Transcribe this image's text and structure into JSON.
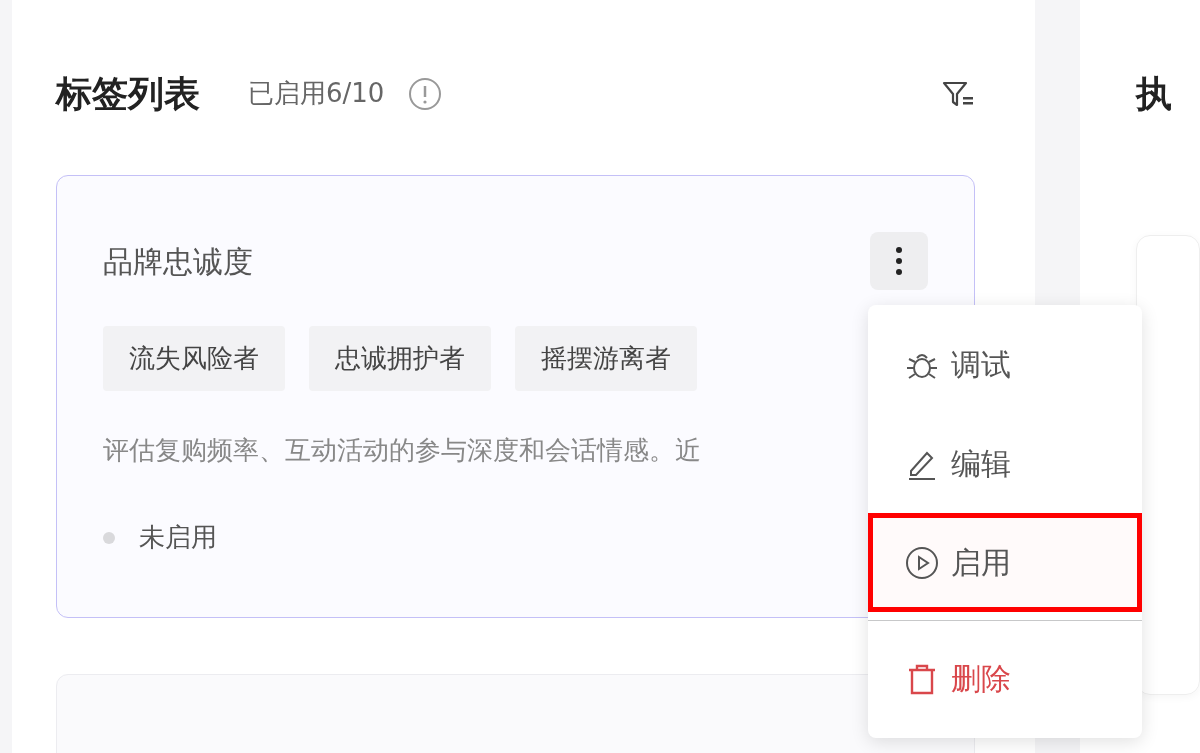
{
  "tag_list": {
    "title": "标签列表",
    "enabled_count": "已启用6/10",
    "cards": [
      {
        "title": "品牌忠诚度",
        "tags": [
          "流失风险者",
          "忠诚拥护者",
          "摇摆游离者"
        ],
        "description": "评估复购频率、互动活动的参与深度和会话情感。近",
        "status": {
          "label": "未启用",
          "enabled": false
        },
        "menu_open": true
      }
    ]
  },
  "menu": [
    {
      "kind": "debug",
      "label": "调试",
      "highlighted": false
    },
    {
      "kind": "edit",
      "label": "编辑",
      "highlighted": false
    },
    {
      "kind": "enable",
      "label": "启用",
      "highlighted": true
    },
    {
      "kind": "delete",
      "label": "删除",
      "highlighted": false
    }
  ],
  "right_panel": {
    "title": "执"
  }
}
